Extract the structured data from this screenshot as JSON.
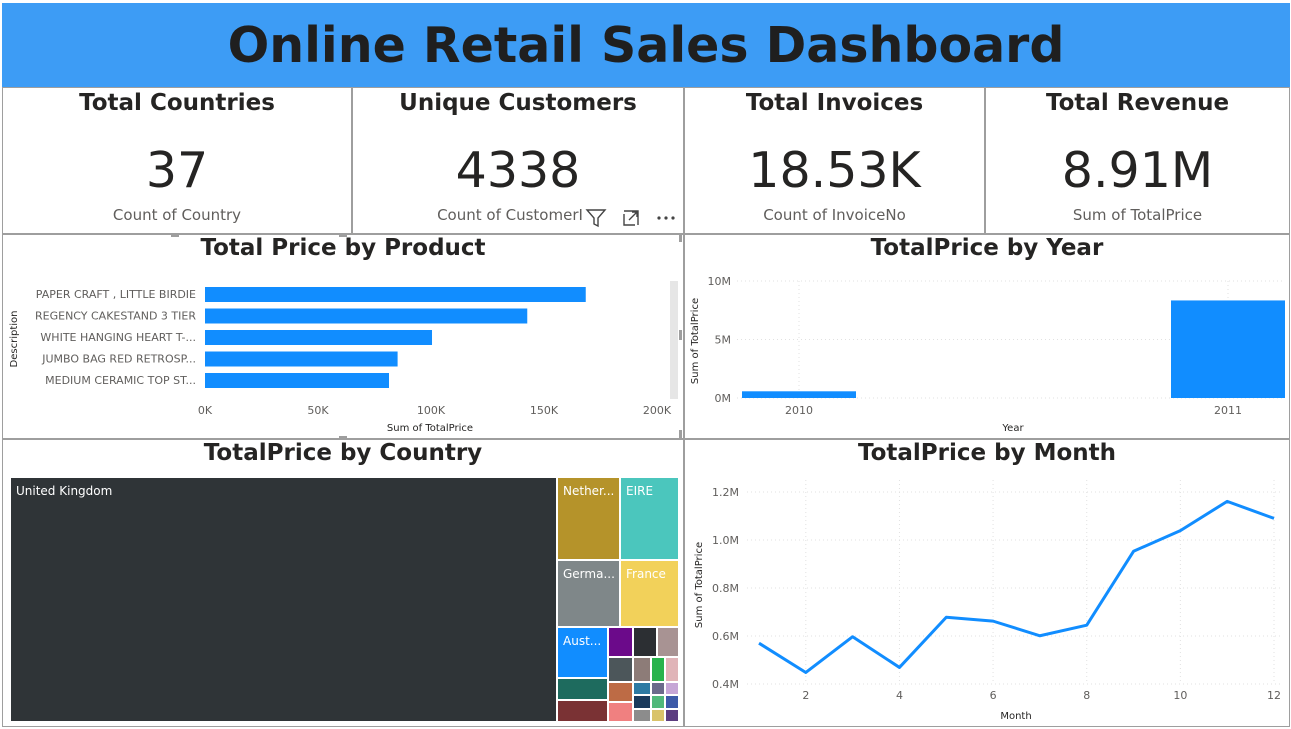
{
  "header": {
    "title": "Online Retail Sales Dashboard"
  },
  "cards": [
    {
      "title": "Total Countries",
      "value": "37",
      "label": "Count of Country"
    },
    {
      "title": "Unique Customers",
      "value": "4338",
      "label": "Count of CustomerI"
    },
    {
      "title": "Total Invoices",
      "value": "18.53K",
      "label": "Count of InvoiceNo"
    },
    {
      "title": "Total Revenue",
      "value": "8.91M",
      "label": "Sum of TotalPrice"
    }
  ],
  "visual_header_icons": [
    "filter-icon",
    "focus-mode-icon",
    "more-options-icon"
  ],
  "colors": {
    "header": "#3d9cf5",
    "accent": "#118dff",
    "uk_tile": "#2f3437"
  },
  "chart_data": [
    {
      "type": "bar",
      "orientation": "horizontal",
      "title": "Total Price by Product",
      "categories": [
        "PAPER CRAFT , LITTLE BIRDIE",
        "REGENCY CAKESTAND 3 TIER",
        "WHITE HANGING HEART T-...",
        "JUMBO BAG RED RETROSP...",
        "MEDIUM CERAMIC TOP ST..."
      ],
      "values": [
        168470,
        142593,
        100448,
        85220,
        81416
      ],
      "xlabel": "Sum of TotalPrice",
      "ylabel": "Description",
      "xlim": [
        0,
        200000
      ],
      "xticks": [
        "0K",
        "50K",
        "100K",
        "150K",
        "200K"
      ]
    },
    {
      "type": "bar",
      "title": "TotalPrice by Year",
      "categories": [
        "2010",
        "2011"
      ],
      "values": [
        572713,
        8338694
      ],
      "xlabel": "Year",
      "ylabel": "Sum of TotalPrice",
      "ylim": [
        0,
        10000000
      ],
      "yticks": [
        "0M",
        "5M",
        "10M"
      ],
      "grid": true
    },
    {
      "type": "treemap",
      "title": "TotalPrice by Country",
      "labels": [
        "United Kingdom",
        "Nether...",
        "EIRE",
        "Germa...",
        "France",
        "Aust..."
      ]
    },
    {
      "type": "line",
      "title": "TotalPrice by Month",
      "x": [
        1,
        2,
        3,
        4,
        5,
        6,
        7,
        8,
        9,
        10,
        11,
        12
      ],
      "values": [
        570000,
        448000,
        597000,
        469000,
        678000,
        662000,
        601000,
        645000,
        953000,
        1039000,
        1161000,
        1090000
      ],
      "xlabel": "Month",
      "ylabel": "Sum of TotalPrice",
      "ylim": [
        400000,
        1250000
      ],
      "yticks": [
        "0.4M",
        "0.6M",
        "0.8M",
        "1.0M",
        "1.2M"
      ],
      "xticks": [
        "2",
        "4",
        "6",
        "8",
        "10",
        "12"
      ],
      "grid": true
    }
  ]
}
